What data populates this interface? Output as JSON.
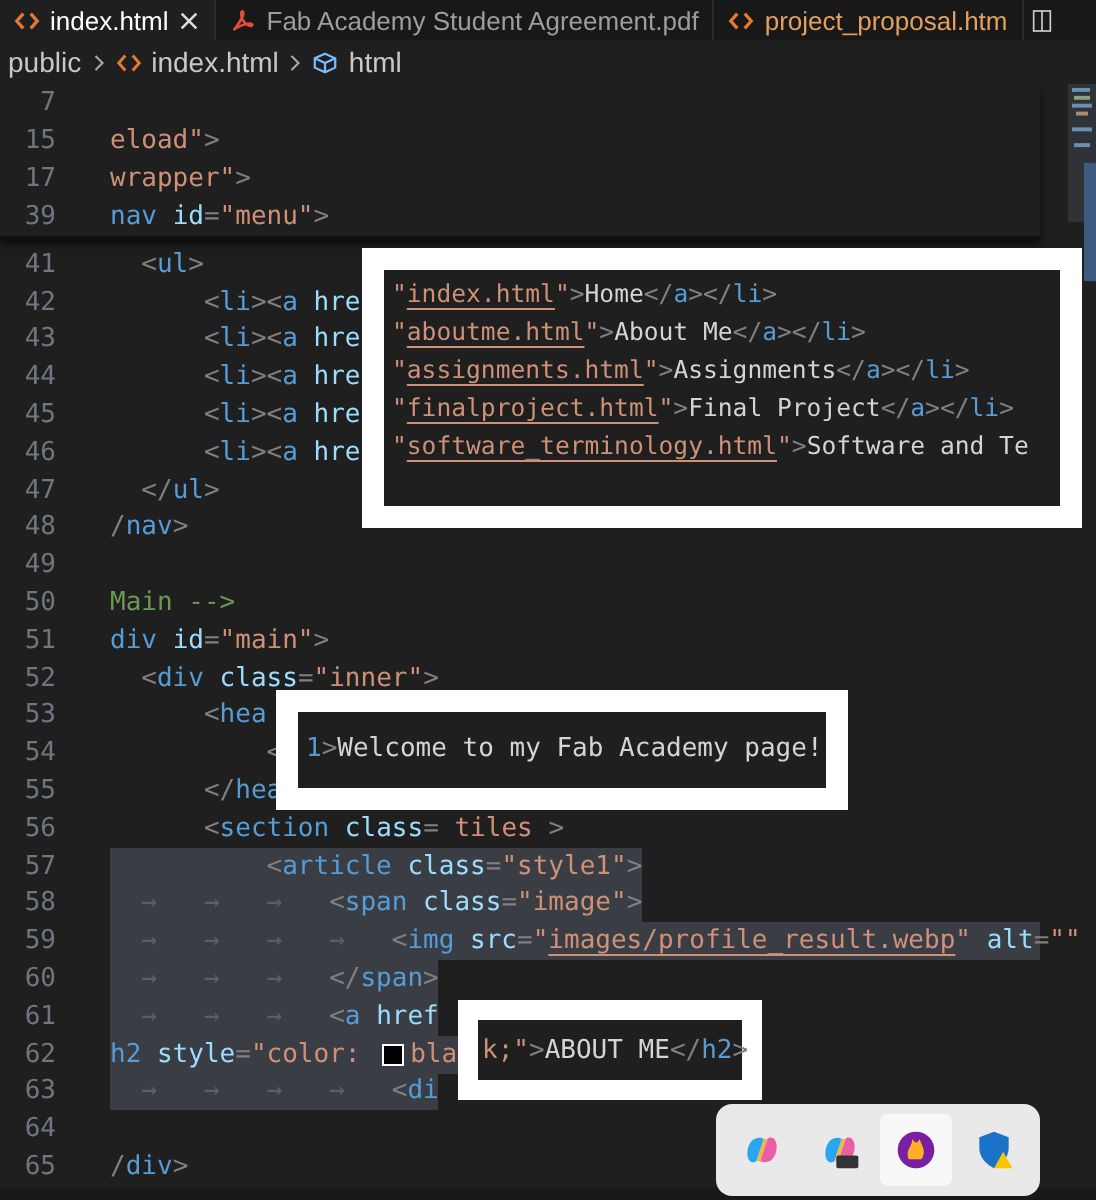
{
  "tabs": [
    {
      "label": "index.html",
      "kind": "html",
      "selected": true,
      "closable": true
    },
    {
      "label": "Fab Academy Student Agreement.pdf",
      "kind": "pdf",
      "selected": false,
      "closable": false
    },
    {
      "label": "project_proposal.htm",
      "kind": "html",
      "selected": false,
      "closable": false
    }
  ],
  "breadcrumb": [
    {
      "label": "public",
      "kind": "folder"
    },
    {
      "label": "index.html",
      "kind": "html"
    },
    {
      "label": "html",
      "kind": "element"
    }
  ],
  "sticky_lines": [
    {
      "number": "7"
    },
    {
      "number": "15",
      "tokens": [
        {
          "kind": "string",
          "text": "eload\""
        },
        {
          "kind": "punct",
          "text": ">"
        }
      ]
    },
    {
      "number": "17",
      "tokens": [
        {
          "kind": "string",
          "text": "wrapper\""
        },
        {
          "kind": "punct",
          "text": ">"
        }
      ]
    },
    {
      "number": "39",
      "tokens": [
        {
          "kind": "tag",
          "text": "nav "
        },
        {
          "kind": "attr",
          "text": "id"
        },
        {
          "kind": "punct",
          "text": "="
        },
        {
          "kind": "string",
          "text": "\"menu\""
        },
        {
          "kind": "punct",
          "text": ">"
        }
      ]
    }
  ],
  "lines": [
    {
      "number": "41",
      "selected": false,
      "tokens": [
        {
          "kind": "punct",
          "text": "  <"
        },
        {
          "kind": "tag",
          "text": "ul"
        },
        {
          "kind": "punct",
          "text": ">"
        }
      ]
    },
    {
      "number": "42",
      "selected": false,
      "tokens": [
        {
          "kind": "punct",
          "text": "      <"
        },
        {
          "kind": "tag",
          "text": "li"
        },
        {
          "kind": "punct",
          "text": "><"
        },
        {
          "kind": "tag",
          "text": "a "
        },
        {
          "kind": "attr",
          "text": "hre"
        }
      ]
    },
    {
      "number": "43",
      "selected": false,
      "tokens": [
        {
          "kind": "punct",
          "text": "      <"
        },
        {
          "kind": "tag",
          "text": "li"
        },
        {
          "kind": "punct",
          "text": "><"
        },
        {
          "kind": "tag",
          "text": "a "
        },
        {
          "kind": "attr",
          "text": "hre"
        }
      ]
    },
    {
      "number": "44",
      "selected": false,
      "tokens": [
        {
          "kind": "punct",
          "text": "      <"
        },
        {
          "kind": "tag",
          "text": "li"
        },
        {
          "kind": "punct",
          "text": "><"
        },
        {
          "kind": "tag",
          "text": "a "
        },
        {
          "kind": "attr",
          "text": "hre"
        }
      ]
    },
    {
      "number": "45",
      "selected": false,
      "tokens": [
        {
          "kind": "punct",
          "text": "      <"
        },
        {
          "kind": "tag",
          "text": "li"
        },
        {
          "kind": "punct",
          "text": "><"
        },
        {
          "kind": "tag",
          "text": "a "
        },
        {
          "kind": "attr",
          "text": "hre"
        }
      ]
    },
    {
      "number": "46",
      "selected": false,
      "tokens": [
        {
          "kind": "punct",
          "text": "      <"
        },
        {
          "kind": "tag",
          "text": "li"
        },
        {
          "kind": "punct",
          "text": "><"
        },
        {
          "kind": "tag",
          "text": "a "
        },
        {
          "kind": "attr",
          "text": "hre"
        }
      ]
    },
    {
      "number": "47",
      "selected": false,
      "tokens": [
        {
          "kind": "punct",
          "text": "  </"
        },
        {
          "kind": "tag",
          "text": "ul"
        },
        {
          "kind": "punct",
          "text": ">"
        }
      ]
    },
    {
      "number": "48",
      "selected": false,
      "tokens": [
        {
          "kind": "punct",
          "text": "/"
        },
        {
          "kind": "tag",
          "text": "nav"
        },
        {
          "kind": "punct",
          "text": ">"
        }
      ]
    },
    {
      "number": "49",
      "selected": false
    },
    {
      "number": "50",
      "selected": false,
      "tokens": [
        {
          "kind": "comment",
          "text": "Main -->"
        }
      ]
    },
    {
      "number": "51",
      "selected": false,
      "tokens": [
        {
          "kind": "tag",
          "text": "div "
        },
        {
          "kind": "attr",
          "text": "id"
        },
        {
          "kind": "punct",
          "text": "="
        },
        {
          "kind": "string",
          "text": "\"main\""
        },
        {
          "kind": "punct",
          "text": ">"
        }
      ]
    },
    {
      "number": "52",
      "selected": false,
      "tokens": [
        {
          "kind": "punct",
          "text": "  <"
        },
        {
          "kind": "tag",
          "text": "div "
        },
        {
          "kind": "attr",
          "text": "class"
        },
        {
          "kind": "punct",
          "text": "="
        },
        {
          "kind": "string",
          "text": "\"inner\""
        },
        {
          "kind": "punct",
          "text": ">"
        }
      ]
    },
    {
      "number": "53",
      "selected": false,
      "tokens": [
        {
          "kind": "punct",
          "text": "      <"
        },
        {
          "kind": "tag",
          "text": "hea"
        }
      ]
    },
    {
      "number": "54",
      "selected": false,
      "tokens": [
        {
          "kind": "punct",
          "text": "          <"
        }
      ]
    },
    {
      "number": "55",
      "selected": false,
      "tokens": [
        {
          "kind": "punct",
          "text": "      </"
        },
        {
          "kind": "tag",
          "text": "hea"
        }
      ]
    },
    {
      "number": "56",
      "selected": false,
      "tokens": [
        {
          "kind": "punct",
          "text": "      <"
        },
        {
          "kind": "tag",
          "text": "section "
        },
        {
          "kind": "attr",
          "text": "class"
        },
        {
          "kind": "punct",
          "text": "="
        },
        {
          "kind": "string",
          "text": " tiles "
        },
        {
          "kind": "punct",
          "text": ">"
        }
      ]
    },
    {
      "number": "57",
      "selected": true,
      "tokens": [
        {
          "kind": "punct",
          "text": "          <"
        },
        {
          "kind": "tag",
          "text": "article "
        },
        {
          "kind": "attr",
          "text": "class"
        },
        {
          "kind": "punct",
          "text": "="
        },
        {
          "kind": "string",
          "text": "\"style1\""
        },
        {
          "kind": "punct",
          "text": ">"
        }
      ]
    },
    {
      "number": "58",
      "selected": true,
      "tokens": [
        {
          "kind": "space",
          "text": "  →   →   →   "
        },
        {
          "kind": "punct",
          "text": "<"
        },
        {
          "kind": "tag",
          "text": "span "
        },
        {
          "kind": "attr",
          "text": "class"
        },
        {
          "kind": "punct",
          "text": "="
        },
        {
          "kind": "string",
          "text": "\"image\""
        },
        {
          "kind": "punct",
          "text": ">"
        }
      ]
    },
    {
      "number": "59",
      "selected": true,
      "tokens": [
        {
          "kind": "space",
          "text": "  →   →   →   →   "
        },
        {
          "kind": "punct",
          "text": "<"
        },
        {
          "kind": "tag",
          "text": "img "
        },
        {
          "kind": "attr",
          "text": "src"
        },
        {
          "kind": "punct",
          "text": "="
        },
        {
          "kind": "string",
          "text": "\""
        },
        {
          "kind": "link",
          "text": "images/profile_result.webp"
        },
        {
          "kind": "string",
          "text": "\" "
        },
        {
          "kind": "attr",
          "text": "alt"
        },
        {
          "kind": "punct",
          "text": "="
        },
        {
          "kind": "string",
          "text": "\"\""
        }
      ]
    },
    {
      "number": "60",
      "selected": true,
      "tokens": [
        {
          "kind": "space",
          "text": "  →   →   →   "
        },
        {
          "kind": "punct",
          "text": "</"
        },
        {
          "kind": "tag",
          "text": "span"
        },
        {
          "kind": "punct",
          "text": ">"
        }
      ]
    },
    {
      "number": "61",
      "selected": true,
      "tokens": [
        {
          "kind": "space",
          "text": "  →   →   →   "
        },
        {
          "kind": "punct",
          "text": "<"
        },
        {
          "kind": "tag",
          "text": "a "
        },
        {
          "kind": "attr",
          "text": "href"
        }
      ]
    },
    {
      "number": "62",
      "selected": true,
      "tokens": [
        {
          "kind": "tag",
          "text": "h2 "
        },
        {
          "kind": "attr",
          "text": "style"
        },
        {
          "kind": "punct",
          "text": "="
        },
        {
          "kind": "string",
          "text": "\"color: "
        },
        {
          "kind": "swatch"
        },
        {
          "kind": "string",
          "text": "bla"
        }
      ]
    },
    {
      "number": "63",
      "selected": true,
      "tokens": [
        {
          "kind": "space",
          "text": "  →   →   →   →   "
        },
        {
          "kind": "punct",
          "text": "<"
        },
        {
          "kind": "tag",
          "text": "di"
        }
      ]
    },
    {
      "number": "64",
      "selected": false
    },
    {
      "number": "65",
      "selected": false,
      "tokens": [
        {
          "kind": "punct",
          "text": "/"
        },
        {
          "kind": "tag",
          "text": "div"
        },
        {
          "kind": "punct",
          "text": ">"
        }
      ]
    }
  ],
  "annotations": [
    {
      "lines": [
        [
          {
            "kind": "string",
            "text": "\""
          },
          {
            "kind": "link",
            "text": "index.html"
          },
          {
            "kind": "string",
            "text": "\""
          },
          {
            "kind": "punct",
            "text": ">"
          },
          {
            "kind": "text",
            "text": "Home"
          },
          {
            "kind": "punct",
            "text": "</"
          },
          {
            "kind": "tag",
            "text": "a"
          },
          {
            "kind": "punct",
            "text": "></"
          },
          {
            "kind": "tag",
            "text": "li"
          },
          {
            "kind": "punct",
            "text": ">"
          }
        ],
        [
          {
            "kind": "string",
            "text": "\""
          },
          {
            "kind": "link",
            "text": "aboutme.html"
          },
          {
            "kind": "string",
            "text": "\""
          },
          {
            "kind": "punct",
            "text": ">"
          },
          {
            "kind": "text",
            "text": "About Me"
          },
          {
            "kind": "punct",
            "text": "</"
          },
          {
            "kind": "tag",
            "text": "a"
          },
          {
            "kind": "punct",
            "text": "></"
          },
          {
            "kind": "tag",
            "text": "li"
          },
          {
            "kind": "punct",
            "text": ">"
          }
        ],
        [
          {
            "kind": "string",
            "text": "\""
          },
          {
            "kind": "link",
            "text": "assignments.html"
          },
          {
            "kind": "string",
            "text": "\""
          },
          {
            "kind": "punct",
            "text": ">"
          },
          {
            "kind": "text",
            "text": "Assignments"
          },
          {
            "kind": "punct",
            "text": "</"
          },
          {
            "kind": "tag",
            "text": "a"
          },
          {
            "kind": "punct",
            "text": "></"
          },
          {
            "kind": "tag",
            "text": "li"
          },
          {
            "kind": "punct",
            "text": ">"
          }
        ],
        [
          {
            "kind": "string",
            "text": "\""
          },
          {
            "kind": "link",
            "text": "finalproject.html"
          },
          {
            "kind": "string",
            "text": "\""
          },
          {
            "kind": "punct",
            "text": ">"
          },
          {
            "kind": "text",
            "text": "Final Project"
          },
          {
            "kind": "punct",
            "text": "</"
          },
          {
            "kind": "tag",
            "text": "a"
          },
          {
            "kind": "punct",
            "text": "></"
          },
          {
            "kind": "tag",
            "text": "li"
          },
          {
            "kind": "punct",
            "text": ">"
          }
        ],
        [
          {
            "kind": "string",
            "text": "\""
          },
          {
            "kind": "link",
            "text": "software_terminology.html"
          },
          {
            "kind": "string",
            "text": "\""
          },
          {
            "kind": "punct",
            "text": ">"
          },
          {
            "kind": "text",
            "text": "Software and Te"
          }
        ]
      ]
    },
    {
      "lines": [
        [
          {
            "kind": "tag",
            "text": "1"
          },
          {
            "kind": "punct",
            "text": ">"
          },
          {
            "kind": "text",
            "text": "Welcome to my Fab Academy page!"
          }
        ]
      ]
    },
    {
      "lines": [
        [
          {
            "kind": "string",
            "text": "k;\""
          },
          {
            "kind": "punct",
            "text": ">"
          },
          {
            "kind": "text",
            "text": "ABOUT ME"
          },
          {
            "kind": "punct",
            "text": "</"
          },
          {
            "kind": "tag",
            "text": "h2"
          },
          {
            "kind": "punct",
            "text": ">"
          }
        ]
      ]
    }
  ],
  "tray_icons": [
    {
      "kind": "swirl",
      "selected": false
    },
    {
      "kind": "swirl-badge",
      "selected": false
    },
    {
      "kind": "flame",
      "selected": true
    },
    {
      "kind": "shield",
      "selected": false
    }
  ]
}
